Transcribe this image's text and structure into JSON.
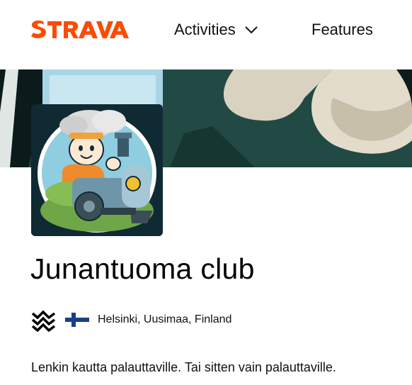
{
  "header": {
    "brand": "STRAVA",
    "nav": {
      "activities_label": "Activities",
      "features_label": "Features"
    },
    "brand_color": "#fc4c02"
  },
  "club": {
    "name": "Junantuoma club",
    "location": "Helsinki, Uusimaa, Finland",
    "description": "Lenkin kautta palauttaville. Tai sitten vain palauttaville.",
    "sport_icon": "multisport-waves-icon",
    "country_flag": "finland-flag"
  }
}
